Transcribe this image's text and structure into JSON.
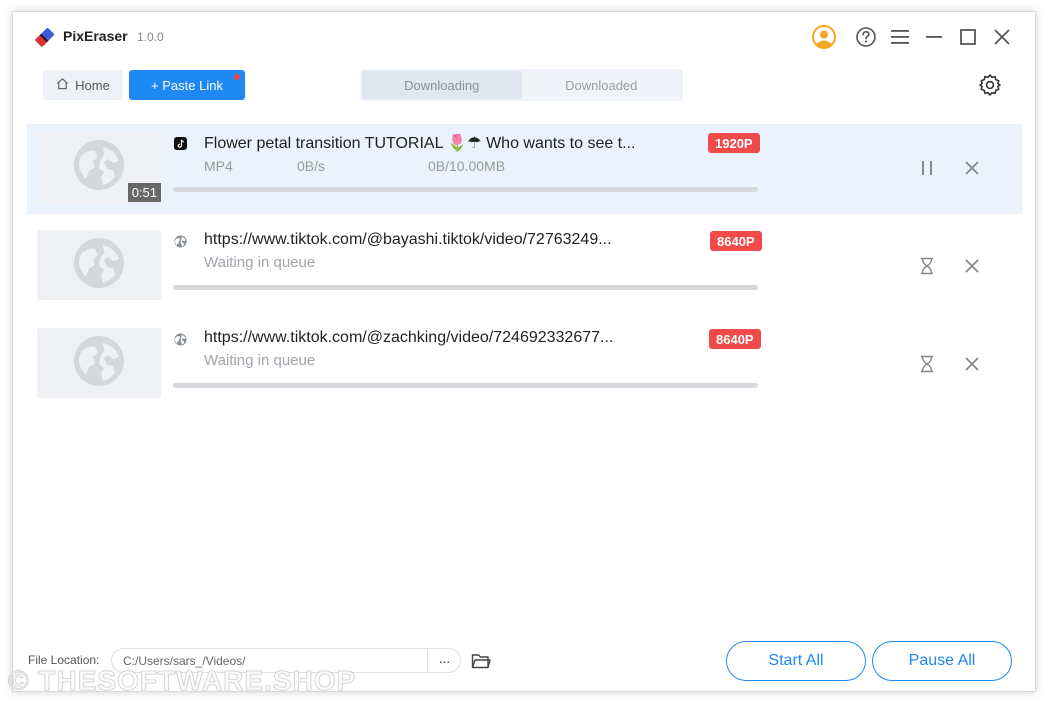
{
  "app": {
    "name": "PixEraser",
    "version": "1.0.0"
  },
  "toolbar": {
    "home_label": "Home",
    "paste_label": "+ Paste Link"
  },
  "tabs": [
    {
      "label": "Downloading",
      "active": true
    },
    {
      "label": "Downloaded",
      "active": false
    }
  ],
  "downloads": [
    {
      "title": "Flower petal transition TUTORIAL 🌷☂ Who wants to see t...",
      "quality": "1920P",
      "format": "MP4",
      "speed": "0B/s",
      "size": "0B/10.00MB",
      "duration": "0:51",
      "source_icon": "tiktok-icon",
      "progress": 0,
      "action_icon": "pause-icon"
    },
    {
      "title": "https://www.tiktok.com/@bayashi.tiktok/video/72763249...",
      "quality": "8640P",
      "status": "Waiting in queue",
      "source_icon": "globe-icon",
      "progress": 0,
      "action_icon": "hourglass-icon"
    },
    {
      "title": "https://www.tiktok.com/@zachking/video/724692332677...",
      "quality": "8640P",
      "status": "Waiting in queue",
      "source_icon": "globe-icon",
      "progress": 0,
      "action_icon": "hourglass-icon"
    }
  ],
  "footer": {
    "file_location_label": "File Location:",
    "file_location_value": "C:/Users/sars_/Videos/",
    "more_label": "···",
    "start_all_label": "Start All",
    "pause_all_label": "Pause All"
  },
  "watermark": "© THESOFTWARE.SHOP",
  "colors": {
    "accent": "#1e88f5",
    "badge": "#f04a4a",
    "active_row": "#eaf3fd",
    "user_icon": "#f5a623"
  }
}
